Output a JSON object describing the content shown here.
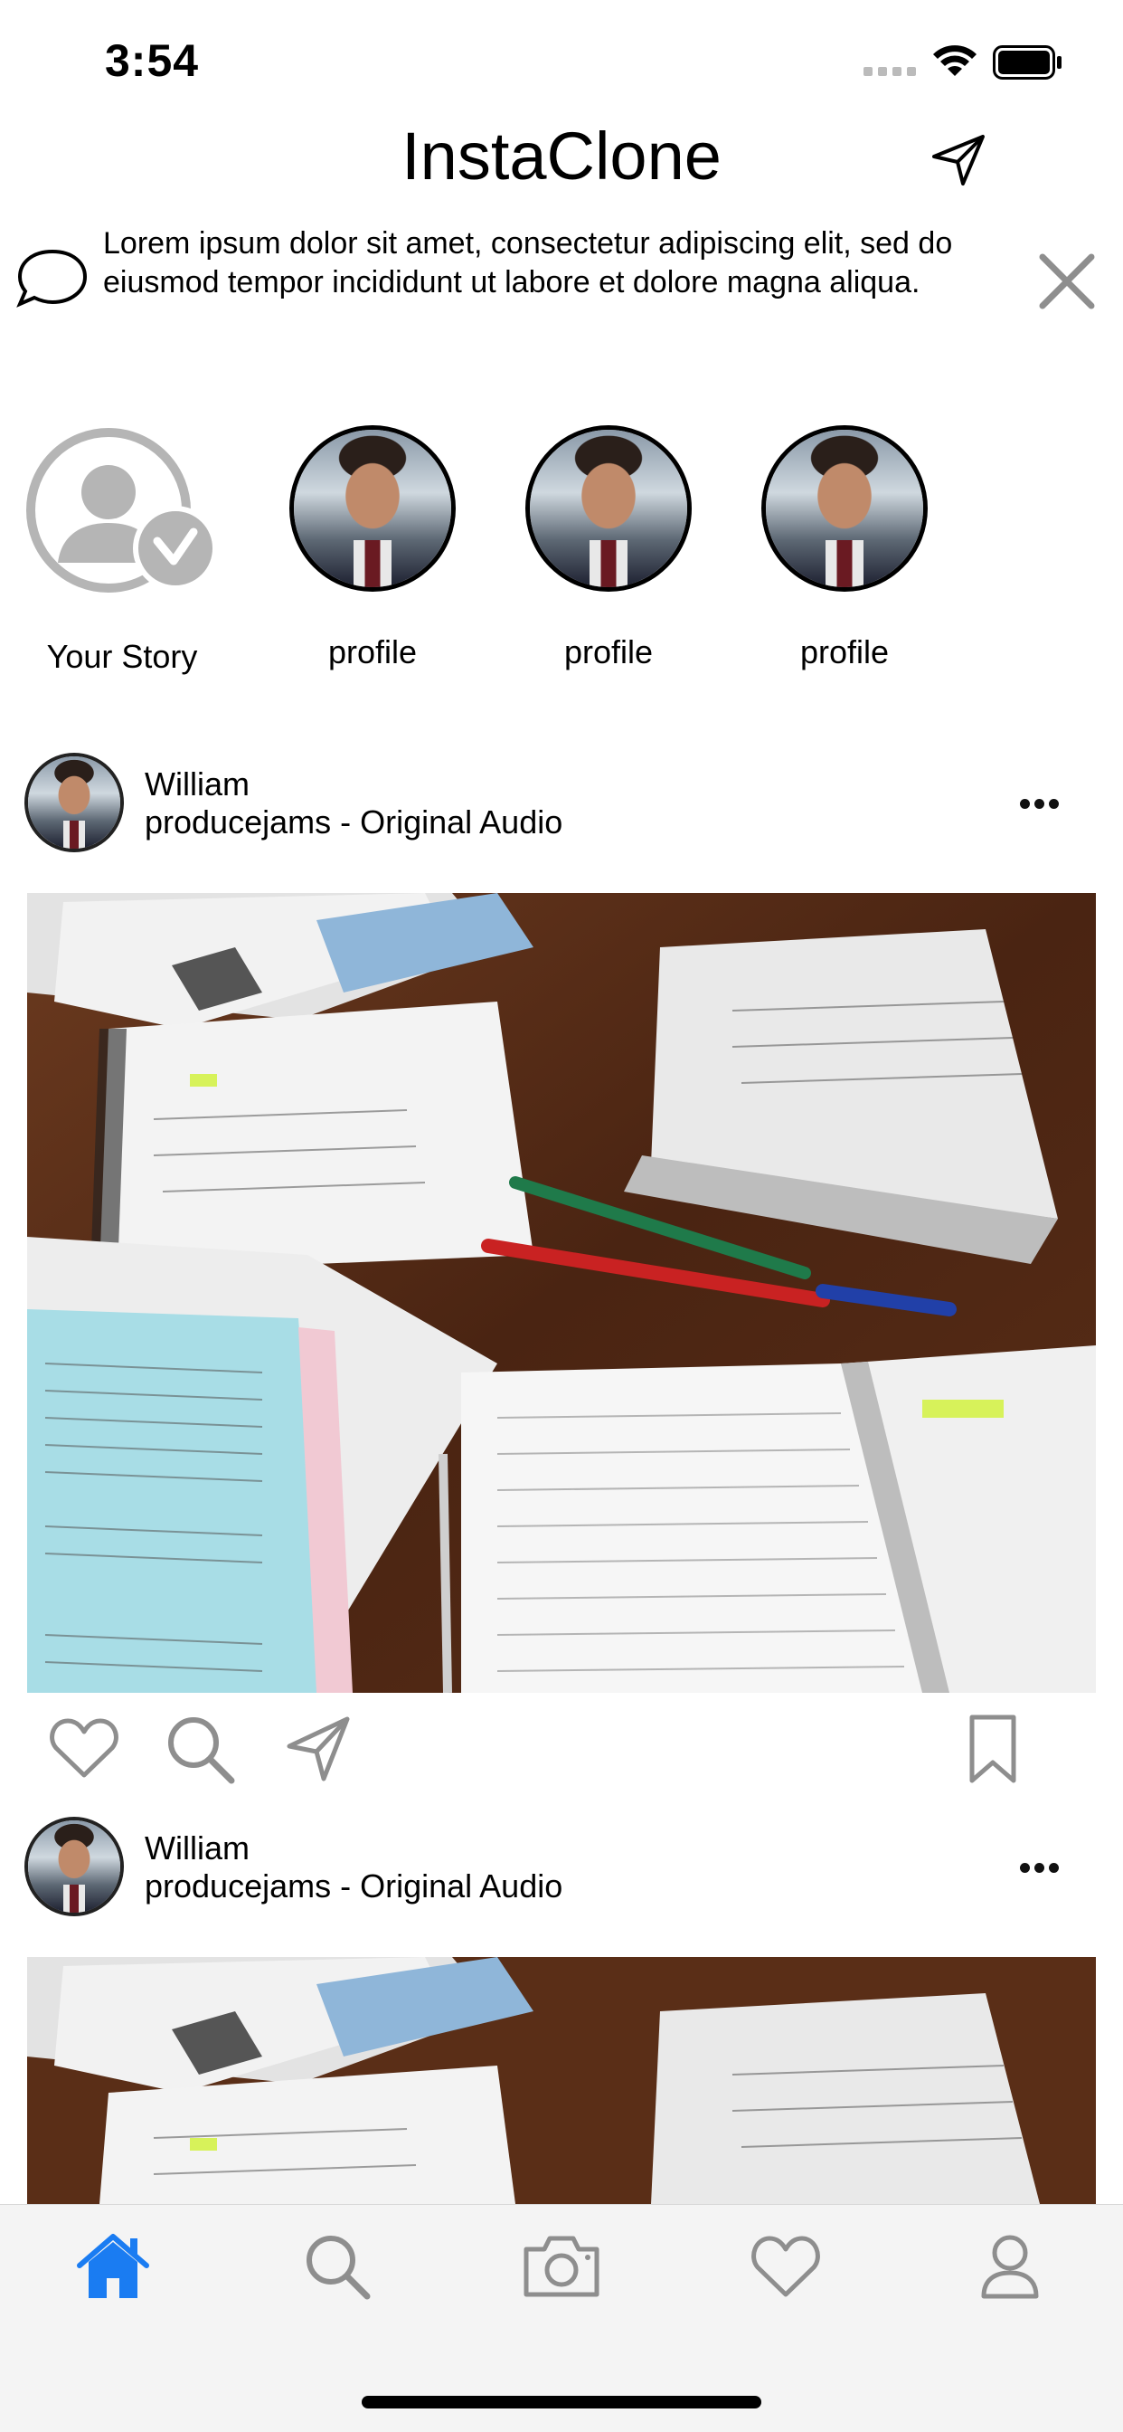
{
  "status_bar": {
    "time": "3:54"
  },
  "header": {
    "title": "InstaClone"
  },
  "banner": {
    "text": "Lorem ipsum dolor sit amet, consectetur adipiscing elit, sed do eiusmod tempor incididunt ut labore et dolore magna aliqua."
  },
  "stories": {
    "your_story_label": "Your Story",
    "items": [
      {
        "label": "profile"
      },
      {
        "label": "profile"
      },
      {
        "label": "profile"
      }
    ]
  },
  "posts": [
    {
      "name": "William",
      "audio": "producejams - Original Audio"
    },
    {
      "name": "William",
      "audio": "producejams - Original Audio"
    }
  ],
  "colors": {
    "accent": "#1a7cf2",
    "icon_gray": "#8e8e8e"
  },
  "tab_bar": {
    "items": [
      "home-icon",
      "search-icon",
      "camera-icon",
      "heart-icon",
      "profile-icon"
    ],
    "selected": "home-icon"
  }
}
